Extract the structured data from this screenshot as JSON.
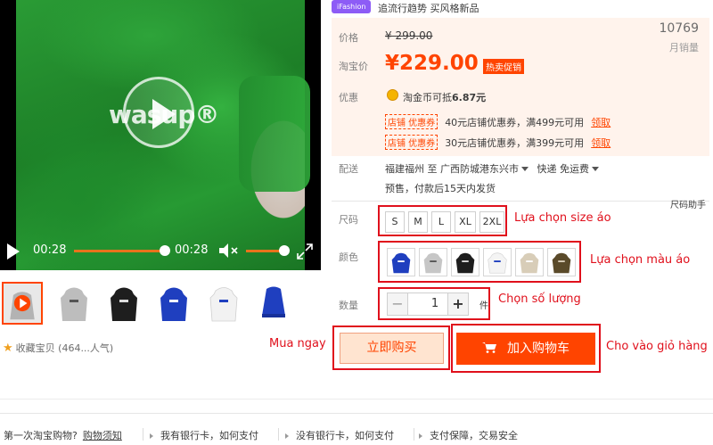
{
  "video": {
    "watermark": "wasup®",
    "current_time": "00:28",
    "duration": "00:28",
    "progress": 1.0,
    "volume": 0.85
  },
  "thumbnails": [
    {
      "name": "video",
      "color": "#b0b0b0"
    },
    {
      "name": "gray",
      "color": "#bdbdbd"
    },
    {
      "name": "black",
      "color": "#1e1e1e"
    },
    {
      "name": "blue",
      "color": "#1f3fbf"
    },
    {
      "name": "white",
      "color": "#f2f2f2"
    },
    {
      "name": "blue-folded",
      "color": "#1f3fbf"
    }
  ],
  "favorite": {
    "label": "收藏宝贝 (464...人气)"
  },
  "header": {
    "tag": "iFashion",
    "tagline": "追流行趋势 买风格新品"
  },
  "price": {
    "orig_label": "价格",
    "orig_value": "¥ 299.00",
    "tb_label": "淘宝价",
    "current": "¥229.00",
    "hot_badge": "热卖促销",
    "sales_num": "10769",
    "sales_label": "月销量"
  },
  "promo": {
    "label": "优惠",
    "coin_text": "淘金币可抵",
    "coin_amount": "6.87元",
    "coupons": [
      {
        "tag": "店铺 优惠券",
        "text": "40元店铺优惠券，满499元可用",
        "link": "领取"
      },
      {
        "tag": "店铺 优惠券",
        "text": "30元店铺优惠券，满399元可用",
        "link": "领取"
      }
    ]
  },
  "shipping": {
    "label": "配送",
    "from": "福建福州",
    "to_word": "至",
    "dest": "广西防城港东兴市",
    "express": "快递",
    "fee": "免运费",
    "presale": "预售，付款后15天内发货"
  },
  "size_help": "尺码助手",
  "size": {
    "label": "尺码",
    "options": [
      "S",
      "M",
      "L",
      "XL",
      "2XL"
    ],
    "annotation": "Lựa chọn size áo"
  },
  "colors": {
    "label": "颜色",
    "options": [
      {
        "name": "blue",
        "hex": "#1f3fbf"
      },
      {
        "name": "gray",
        "hex": "#c6c6c6"
      },
      {
        "name": "black",
        "hex": "#1e1e1e"
      },
      {
        "name": "white",
        "hex": "#f4f4f4"
      },
      {
        "name": "beige",
        "hex": "#d8cdb8"
      },
      {
        "name": "olive",
        "hex": "#5a4a2a"
      }
    ],
    "annotation": "Lựa chọn màu áo"
  },
  "quantity": {
    "label": "数量",
    "minus": "−",
    "value": "1",
    "plus": "+",
    "unit": "件",
    "annotation": "Chọn số lượng"
  },
  "actions": {
    "buy_label": "立即购买",
    "buy_annotation": "Mua ngay",
    "cart_label": "加入购物车",
    "cart_annotation": "Cho vào giỏ hàng"
  },
  "footer": {
    "q1": "第一次淘宝购物?",
    "q1_link": "购物须知",
    "q2": "我有银行卡，如何支付",
    "q3": "没有银行卡，如何支付",
    "q4": "支付保障，交易安全"
  }
}
